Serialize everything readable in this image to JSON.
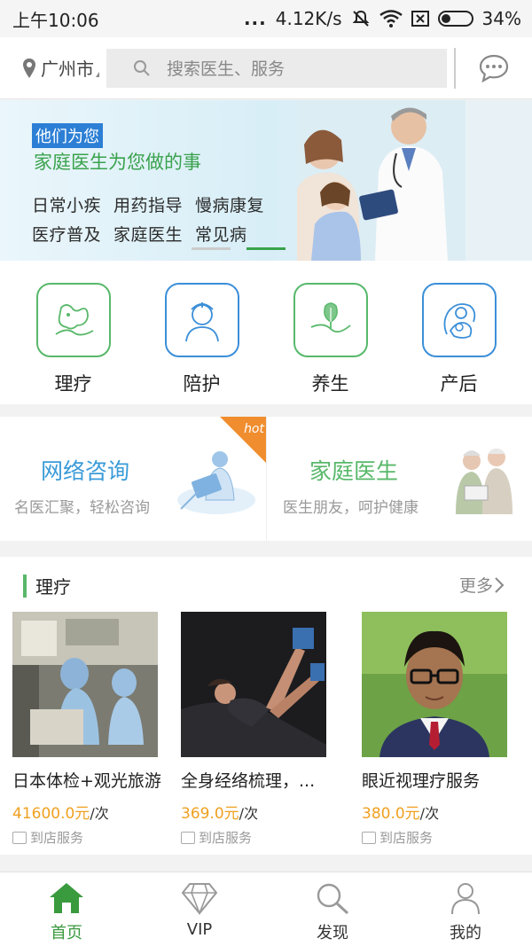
{
  "status_bar": {
    "time": "上午10:06",
    "dots": "...",
    "speed": "4.12K/s",
    "battery": "34%",
    "battery_level": 0.34
  },
  "top_bar": {
    "city": "广州市",
    "search_placeholder": "搜索医生、服务",
    "icons": [
      "location-pin-icon",
      "search-icon",
      "chat-bubble-icon"
    ]
  },
  "banner": {
    "tag": "他们为您",
    "headline": "家庭医生为您做的事",
    "row1": [
      "日常小疾",
      "用药指导",
      "慢病康复"
    ],
    "row2": [
      "医疗普及",
      "家庭医生",
      "常见病"
    ],
    "colors": {
      "tag_bg": "#2c7fd5",
      "headline": "#3aa24d"
    }
  },
  "categories": [
    {
      "label": "理疗",
      "icon": "massage-icon",
      "border": "green"
    },
    {
      "label": "陪护",
      "icon": "nurse-icon",
      "border": "blue"
    },
    {
      "label": "养生",
      "icon": "leaf-icon",
      "border": "green"
    },
    {
      "label": "产后",
      "icon": "mother-baby-icon",
      "border": "blue"
    }
  ],
  "consult": [
    {
      "title": "网络咨询",
      "subtitle": "名医汇聚，轻松咨询",
      "badge": "hot"
    },
    {
      "title": "家庭医生",
      "subtitle": "医生朋友，呵护健康"
    }
  ],
  "section": {
    "title": "理疗",
    "more": "更多",
    "products": [
      {
        "name": "日本体检+观光旅游",
        "price": "41600.0元",
        "unit": "/次",
        "service": "到店服务"
      },
      {
        "name": "全身经络梳理，...",
        "price": "369.0元",
        "unit": "/次",
        "service": "到店服务"
      },
      {
        "name": "眼近视理疗服务",
        "price": "380.0元",
        "unit": "/次",
        "service": "到店服务"
      }
    ]
  },
  "bottom_nav": [
    {
      "label": "首页",
      "icon": "home-icon",
      "active": true
    },
    {
      "label": "VIP",
      "icon": "diamond-icon",
      "active": false
    },
    {
      "label": "发现",
      "icon": "search-icon",
      "active": false
    },
    {
      "label": "我的",
      "icon": "person-icon",
      "active": false
    }
  ],
  "colors": {
    "accent_green": "#58b86a",
    "accent_blue": "#3b8fd8",
    "price": "#f0a020",
    "hot": "#f08d2f"
  }
}
